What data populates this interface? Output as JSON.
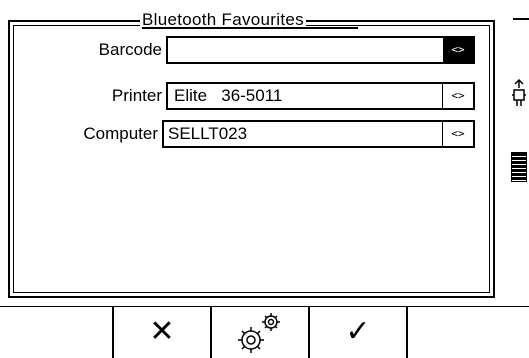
{
  "dialog": {
    "title": "Bluetooth Favourites",
    "fields": [
      {
        "label": "Barcode",
        "value": "",
        "button": "<>",
        "selected": true
      },
      {
        "label": "Printer",
        "value": "Elite   36-5011",
        "button": "<>",
        "selected": false
      },
      {
        "label": "Computer",
        "value": "SELLT023",
        "button": "<>",
        "selected": false
      }
    ]
  },
  "softkeys": {
    "cancel": "✕",
    "settings_icon": "gears-icon",
    "confirm": "✓"
  },
  "side_icons": {
    "top": "usb-plug-icon",
    "bottom": "battery-icon"
  }
}
